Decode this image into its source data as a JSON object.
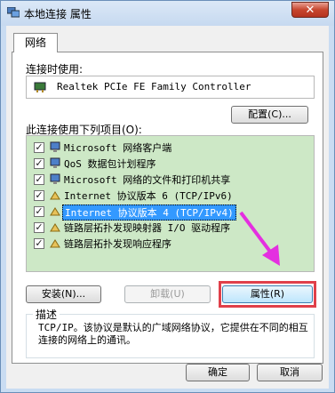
{
  "window": {
    "title": "本地连接 属性",
    "close_label": "✕"
  },
  "tab": {
    "label": "网络"
  },
  "connect_using": {
    "label": "连接时使用:",
    "adapter": "Realtek PCIe FE Family Controller",
    "configure_button": "配置(C)..."
  },
  "items_section": {
    "label": "此连接使用下列项目(O):",
    "items": [
      {
        "label": "Microsoft 网络客户端",
        "checked": true,
        "icon": "network-client-icon"
      },
      {
        "label": "QoS 数据包计划程序",
        "checked": true,
        "icon": "qos-scheduler-icon"
      },
      {
        "label": "Microsoft 网络的文件和打印机共享",
        "checked": true,
        "icon": "file-printer-sharing-icon"
      },
      {
        "label": "Internet 协议版本 6 (TCP/IPv6)",
        "checked": true,
        "icon": "protocol-icon"
      },
      {
        "label": "Internet 协议版本 4 (TCP/IPv4)",
        "checked": true,
        "icon": "protocol-icon",
        "selected": true
      },
      {
        "label": "链路层拓扑发现映射器 I/O 驱动程序",
        "checked": true,
        "icon": "protocol-icon"
      },
      {
        "label": "链路层拓扑发现响应程序",
        "checked": true,
        "icon": "protocol-icon"
      }
    ]
  },
  "actions": {
    "install": "安装(N)...",
    "uninstall": "卸载(U)",
    "properties": "属性(R)"
  },
  "description": {
    "title": "描述",
    "text": "TCP/IP。该协议是默认的广域网络协议，它提供在不同的相互连接的网络上的通讯。"
  },
  "footer": {
    "ok": "确定",
    "cancel": "取消"
  },
  "colors": {
    "highlight": "#3399ff",
    "annotation_arrow": "#e42fe0",
    "annotation_box": "#e0404a",
    "list_background": "#cde8c6"
  }
}
